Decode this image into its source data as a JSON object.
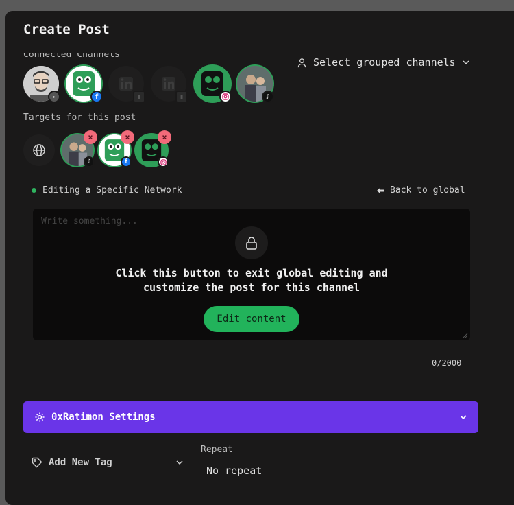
{
  "dialog": {
    "title": "Create Post"
  },
  "connected": {
    "label": "Connected Channels",
    "group_select_label": "Select grouped channels",
    "channels": [
      {
        "name": "user-avatar",
        "network": "youtube",
        "selected": false
      },
      {
        "name": "ratimon-avatar",
        "network": "facebook",
        "selected": true
      },
      {
        "name": "linkedin-avatar",
        "network": "linkedin",
        "selected": false
      },
      {
        "name": "linkedin-page-avatar",
        "network": "linkedin",
        "selected": false
      },
      {
        "name": "ratimon-avatar",
        "network": "instagram",
        "selected": true
      },
      {
        "name": "group-photo-avatar",
        "network": "tiktok",
        "selected": true
      }
    ]
  },
  "targets": {
    "label": "Targets for this post",
    "items": [
      {
        "network": "tiktok"
      },
      {
        "network": "facebook"
      },
      {
        "network": "instagram"
      }
    ]
  },
  "editing": {
    "status": "Editing a Specific Network",
    "back_label": "Back to global",
    "placeholder": "Write something...",
    "lock_message": "Click this button to exit global editing and customize the post for this channel",
    "edit_button": "Edit content",
    "counter": "0/2000"
  },
  "settings": {
    "label": "0xRatimon Settings"
  },
  "tags": {
    "label": "Add New Tag"
  },
  "repeat": {
    "label": "Repeat",
    "value": "No repeat"
  },
  "colors": {
    "accent_purple": "#6a35e8",
    "accent_green": "#22b35b",
    "remove_red": "#f26a7a"
  }
}
